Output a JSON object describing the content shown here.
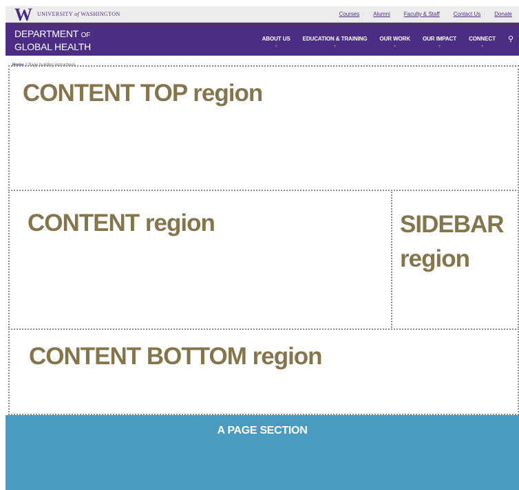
{
  "topbar": {
    "logo": "W",
    "university": "UNIVERSITY",
    "of": "of",
    "washington": "WASHINGTON",
    "links": [
      "Courses",
      "Alumni",
      "Faculty & Staff",
      "Contact Us",
      "Donate"
    ]
  },
  "header": {
    "dept_line1": "DEPARTMENT",
    "dept_line1_small": "OF",
    "dept_line2": "GLOBAL HEALTH",
    "nav": [
      "ABOUT US",
      "EDUCATION & TRAINING",
      "OUR WORK",
      "OUR IMPACT",
      "CONNECT"
    ],
    "search_glyph": "⚲"
  },
  "breadcrumb": {
    "home": "Home",
    "separator": "//",
    "current": "Page building instructions"
  },
  "regions": {
    "content_top": "CONTENT TOP region",
    "content": "CONTENT region",
    "sidebar_line1": "SIDEBAR",
    "sidebar_line2": "region",
    "content_bottom": "CONTENT BOTTOM region"
  },
  "page_section": {
    "title": "A PAGE SECTION"
  },
  "colors": {
    "uw_purple": "#4b2e83",
    "region_gold": "#85754d",
    "section_blue": "#4a9bbd"
  }
}
